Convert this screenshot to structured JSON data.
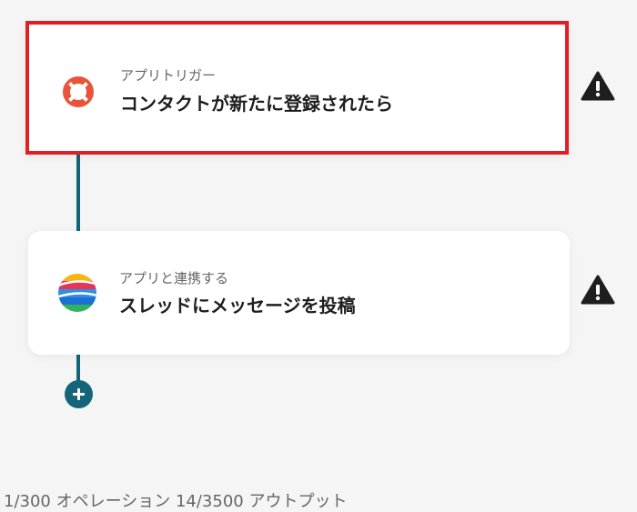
{
  "flow": {
    "steps": [
      {
        "subtitle": "アプリトリガー",
        "title": "コンタクトが新たに登録されたら",
        "app_icon": "lifebuoy-icon",
        "warning_icon": "warning-icon",
        "selected": true
      },
      {
        "subtitle": "アプリと連携する",
        "title": "スレッドにメッセージを投稿",
        "app_icon": "colorful-sphere-icon",
        "warning_icon": "warning-icon",
        "selected": false
      }
    ],
    "add_icon": "plus-icon"
  },
  "footer": {
    "usage_text": "1/300 オペレーション  14/3500 アウトプット"
  },
  "colors": {
    "background": "#f5f5f5",
    "connector": "#14657a",
    "selection_border": "#e01e24",
    "warning": "#1e1e1e"
  }
}
